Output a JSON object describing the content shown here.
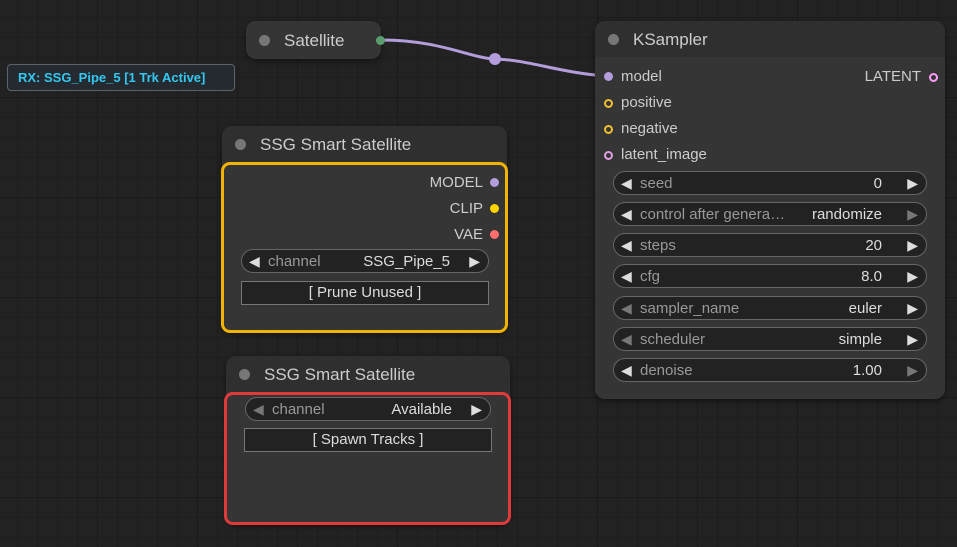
{
  "badge": {
    "text": "RX: SSG_Pipe_5 [1 Trk Active]",
    "color": "#33c8f0"
  },
  "satellite_node": {
    "title": "Satellite",
    "output_pin_color": "#5a9e6f"
  },
  "ksampler": {
    "title": "KSampler",
    "inputs": [
      {
        "label": "model",
        "color": "#b39ddb"
      },
      {
        "label": "positive",
        "color": "#f0c030"
      },
      {
        "label": "negative",
        "color": "#f0c030"
      },
      {
        "label": "latent_image",
        "color": "#e0a0e0"
      }
    ],
    "output": {
      "label": "LATENT",
      "color": "#ff9cf9"
    },
    "widgets": [
      {
        "label": "seed",
        "value": "0"
      },
      {
        "label": "control after genera…",
        "value": "randomize"
      },
      {
        "label": "steps",
        "value": "20"
      },
      {
        "label": "cfg",
        "value": "8.0"
      },
      {
        "label": "sampler_name",
        "value": "euler"
      },
      {
        "label": "scheduler",
        "value": "simple"
      },
      {
        "label": "denoise",
        "value": "1.00"
      }
    ]
  },
  "smart_satellite_1": {
    "title": "SSG Smart Satellite",
    "outline_color": "#f0b400",
    "outputs": [
      {
        "label": "MODEL",
        "color": "#b39ddb"
      },
      {
        "label": "CLIP",
        "color": "#ffd500"
      },
      {
        "label": "VAE",
        "color": "#ff6e6e"
      }
    ],
    "channel": {
      "label": "channel",
      "value": "SSG_Pipe_5"
    },
    "button_label": "[ Prune Unused ]"
  },
  "smart_satellite_2": {
    "title": "SSG Smart Satellite",
    "outline_color": "#e03a3a",
    "channel": {
      "label": "channel",
      "value": "Available"
    },
    "button_label": "[ Spawn Tracks ]"
  },
  "link_color": "#b39ddb"
}
